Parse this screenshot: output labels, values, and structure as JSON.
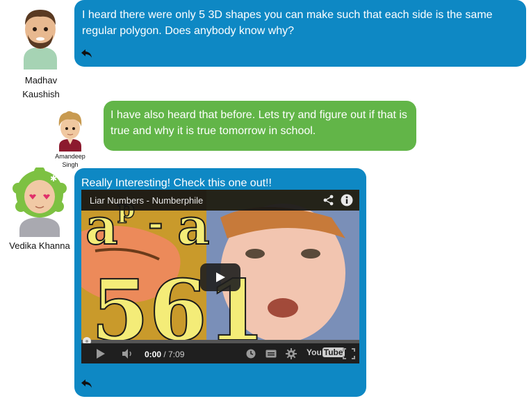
{
  "messages": [
    {
      "author": [
        "Madhav",
        "Kaushish"
      ],
      "text_lines": [
        "I heard there were only 5 3D shapes you can make such that each side is the same",
        "regular polygon. Does anybody know why?"
      ],
      "color": "#0e88c4"
    },
    {
      "author": [
        "Amandeep",
        "Singh"
      ],
      "text_lines": [
        "I have also heard that before. Lets try and figure out if that is",
        "true and why it is true tomorrow in school."
      ],
      "color": "#62b548"
    },
    {
      "author": [
        "Vedika Khanna"
      ],
      "text_lines": [
        "Really Interesting! Check this one out!!"
      ],
      "color": "#0e88c4",
      "video": {
        "title": "Liar Numbers - Numberphile",
        "current_time": "0:00",
        "duration": "7:09",
        "progress": 0,
        "thumbnail_text": [
          "a",
          "p",
          "-",
          "a",
          "561"
        ],
        "brand": [
          "You",
          "Tube"
        ]
      }
    }
  ]
}
